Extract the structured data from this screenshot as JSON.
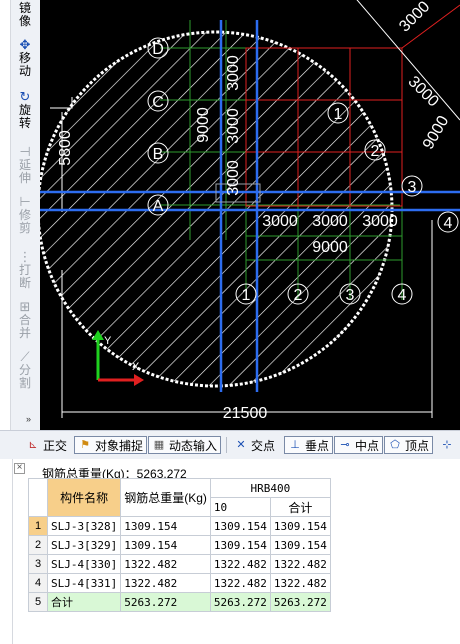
{
  "sidebar": {
    "tools": [
      {
        "icon": "mirror-icon",
        "glyph": "",
        "label": "镜像",
        "enabled": true
      },
      {
        "icon": "move-icon",
        "glyph": "✥",
        "label": "移动",
        "enabled": true
      },
      {
        "icon": "rotate-icon",
        "glyph": "↻",
        "label": "旋转",
        "enabled": true
      },
      {
        "icon": "extend-icon",
        "glyph": "⊣",
        "label": "延伸",
        "enabled": false
      },
      {
        "icon": "trim-icon",
        "glyph": "⊢",
        "label": "修剪",
        "enabled": false
      },
      {
        "icon": "break-icon",
        "glyph": "⋮",
        "label": "打断",
        "enabled": false
      },
      {
        "icon": "merge-icon",
        "glyph": "⊞",
        "label": "合并",
        "enabled": false
      },
      {
        "icon": "split-icon",
        "glyph": "⟋",
        "label": "分割",
        "enabled": false
      }
    ],
    "more": "»"
  },
  "drawing": {
    "grid_rows": [
      "D",
      "C",
      "B",
      "A"
    ],
    "grid_cols": [
      "1",
      "2",
      "3",
      "4"
    ],
    "right_labels": [
      "3",
      "4"
    ],
    "inner_labels": [
      "1",
      "2"
    ],
    "vertical_dims": [
      "9000",
      "3000",
      "3000",
      "3000"
    ],
    "horizontal_dims": [
      "3000",
      "3000",
      "3000"
    ],
    "horizontal_total": "9000",
    "diag_dims": [
      "3000",
      "3000",
      "9000"
    ],
    "left_dim": "5800",
    "diameter_dim": "21500",
    "axis_x": "X",
    "axis_y": "Y"
  },
  "toolbar": {
    "ortho": "正交",
    "snap": "对象捕捉",
    "dynamic": "动态输入",
    "intersection": "交点",
    "perpendicular": "垂点",
    "midpoint": "中点",
    "vertex": "顶点"
  },
  "panel": {
    "summary": "钢筋总重量(Kg)：5263.272",
    "headers": {
      "name": "构件名称",
      "total": "钢筋总重量(Kg)",
      "grade": "HRB400",
      "dia": "10",
      "sum": "合计"
    },
    "rows": [
      {
        "num": "1",
        "name": "SLJ-3[328]",
        "total": "1309.154",
        "dia": "1309.154",
        "sum": "1309.154"
      },
      {
        "num": "2",
        "name": "SLJ-3[329]",
        "total": "1309.154",
        "dia": "1309.154",
        "sum": "1309.154"
      },
      {
        "num": "3",
        "name": "SLJ-4[330]",
        "total": "1322.482",
        "dia": "1322.482",
        "sum": "1322.482"
      },
      {
        "num": "4",
        "name": "SLJ-4[331]",
        "total": "1322.482",
        "dia": "1322.482",
        "sum": "1322.482"
      },
      {
        "num": "5",
        "name": "合计",
        "total": "5263.272",
        "dia": "5263.272",
        "sum": "5263.272"
      }
    ]
  }
}
